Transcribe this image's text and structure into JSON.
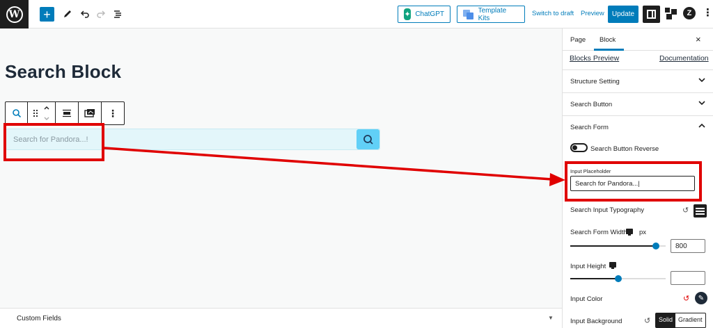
{
  "topbar": {
    "chatgpt_label": "ChatGPT",
    "template_kits_label": "Template Kits",
    "switch_draft": "Switch to draft",
    "preview": "Preview",
    "update": "Update",
    "add": "+",
    "more": "⋮"
  },
  "editor": {
    "page_title": "Search Block",
    "search_placeholder": "Search for Pandora...!",
    "custom_fields": "Custom Fields"
  },
  "sidebar": {
    "tabs": [
      "Page",
      "Block"
    ],
    "close": "×",
    "blocks_preview": "Blocks Preview",
    "documentation": "Documentation",
    "sections": [
      "Structure Setting",
      "Search Button",
      "Search Form"
    ],
    "search_button_reverse": "Search Button Reverse",
    "input_placeholder_label": "Input Placeholder",
    "input_placeholder_value": "Search for Pandora...|",
    "search_input_typography": "Search Input Typography",
    "search_form_width": "Search Form Width",
    "unit": "px",
    "form_width_value": "800",
    "form_width_level": 0.9,
    "input_height": "Input Height",
    "input_height_value": "",
    "input_height_level": 0.5,
    "input_color": "Input Color",
    "input_background": "Input Background",
    "bg_options": [
      "Solid",
      "Gradient"
    ]
  },
  "colors": {
    "accent": "#007cba",
    "search_button": "#61d0f7",
    "annotation": "#e00000"
  }
}
